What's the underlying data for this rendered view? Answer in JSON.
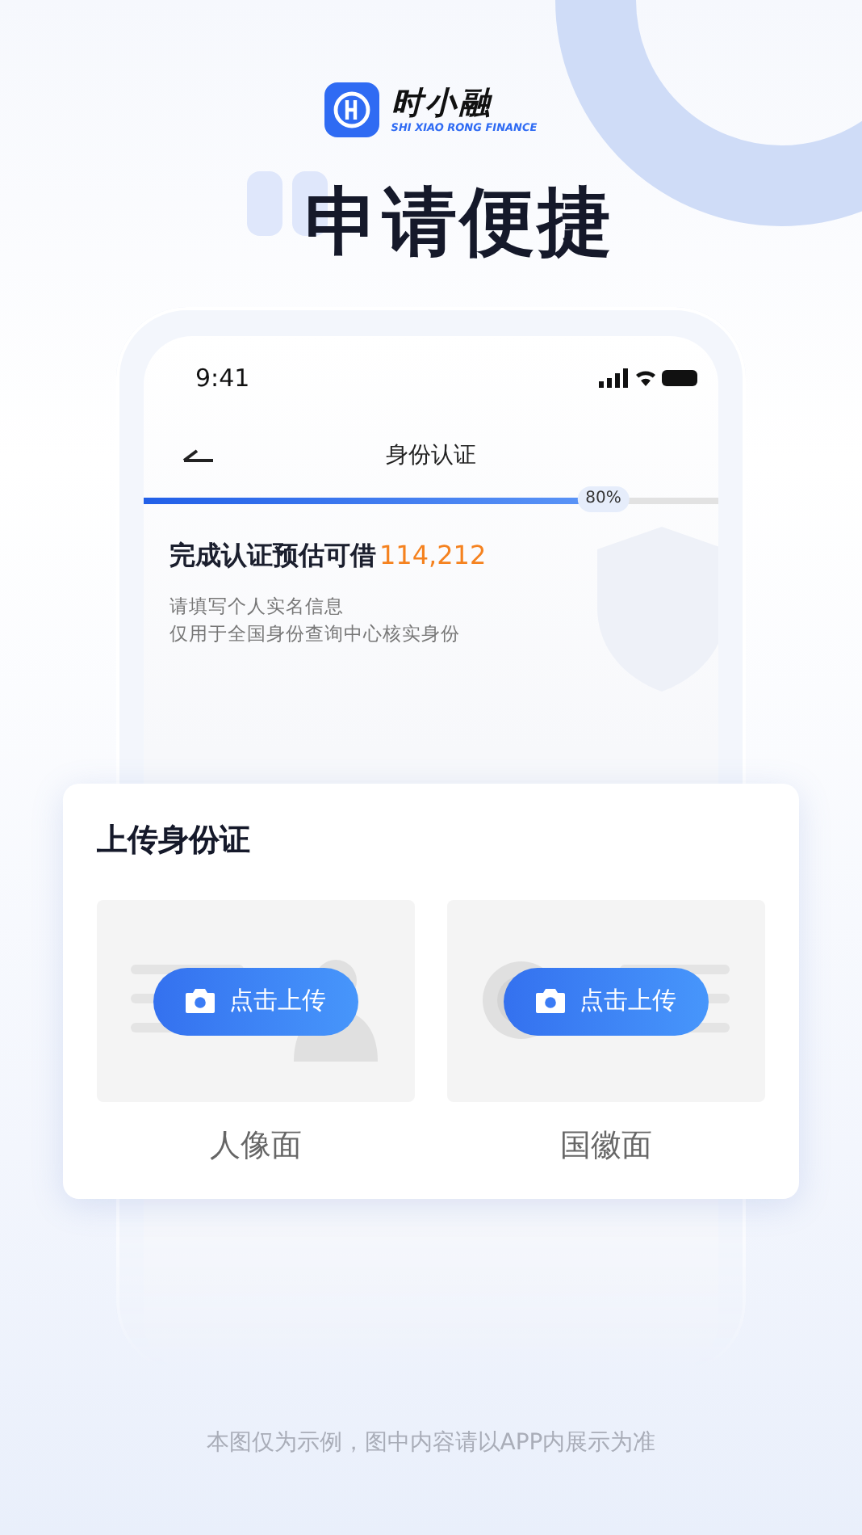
{
  "logo": {
    "name": "时小融",
    "tagline": "SHI XIAO RONG FINANCE"
  },
  "headline": "申请便捷",
  "phone": {
    "status_bar": {
      "time": "9:41"
    },
    "nav": {
      "title": "身份认证"
    },
    "progress": {
      "level": 0.8,
      "label": "80%"
    },
    "estimate": {
      "text": "完成认证预估可借",
      "amount": "114,212"
    },
    "notes": [
      "请填写个人实名信息",
      "仅用于全国身份查询中心核实身份"
    ]
  },
  "upload_card": {
    "title": "上传身份证",
    "slots": [
      {
        "kind": "portrait",
        "button": "点击上传",
        "caption": "人像面"
      },
      {
        "kind": "emblem",
        "button": "点击上传",
        "caption": "国徽面"
      }
    ]
  },
  "footer": "本图仅为示例，图中内容请以APP内展示为准"
}
